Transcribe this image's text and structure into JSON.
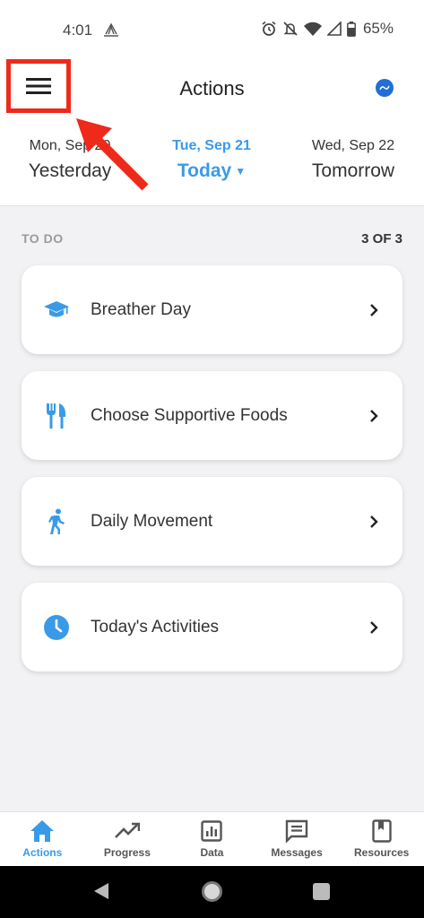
{
  "status_bar": {
    "time": "4:01",
    "battery": "65%",
    "icons": [
      "note-icon",
      "alarm-icon",
      "notifications-off-icon",
      "wifi-icon",
      "signal-icon",
      "battery-icon"
    ]
  },
  "app_bar": {
    "title": "Actions",
    "menu_icon": "hamburger-menu-icon"
  },
  "dates": {
    "prev": {
      "date": "Mon, Sep 20",
      "label": "Yesterday"
    },
    "current": {
      "date": "Tue, Sep 21",
      "label": "Today"
    },
    "next": {
      "date": "Wed, Sep 22",
      "label": "Tomorrow"
    }
  },
  "todo": {
    "label": "TO DO",
    "count": "3 OF 3",
    "items": [
      {
        "label": "Breather Day",
        "icon": "graduation-cap-icon"
      },
      {
        "label": "Choose Supportive Foods",
        "icon": "utensils-icon"
      },
      {
        "label": "Daily Movement",
        "icon": "walking-icon"
      },
      {
        "label": "Today's Activities",
        "icon": "clock-icon"
      }
    ]
  },
  "tabs": [
    {
      "label": "Actions",
      "icon": "home-icon",
      "active": true
    },
    {
      "label": "Progress",
      "icon": "trending-up-icon",
      "active": false
    },
    {
      "label": "Data",
      "icon": "bar-chart-icon",
      "active": false
    },
    {
      "label": "Messages",
      "icon": "message-icon",
      "active": false
    },
    {
      "label": "Resources",
      "icon": "book-icon",
      "active": false
    }
  ],
  "colors": {
    "accent": "#3a9ae8",
    "highlight_box": "#ee2a1b",
    "background": "#f2f2f4"
  }
}
